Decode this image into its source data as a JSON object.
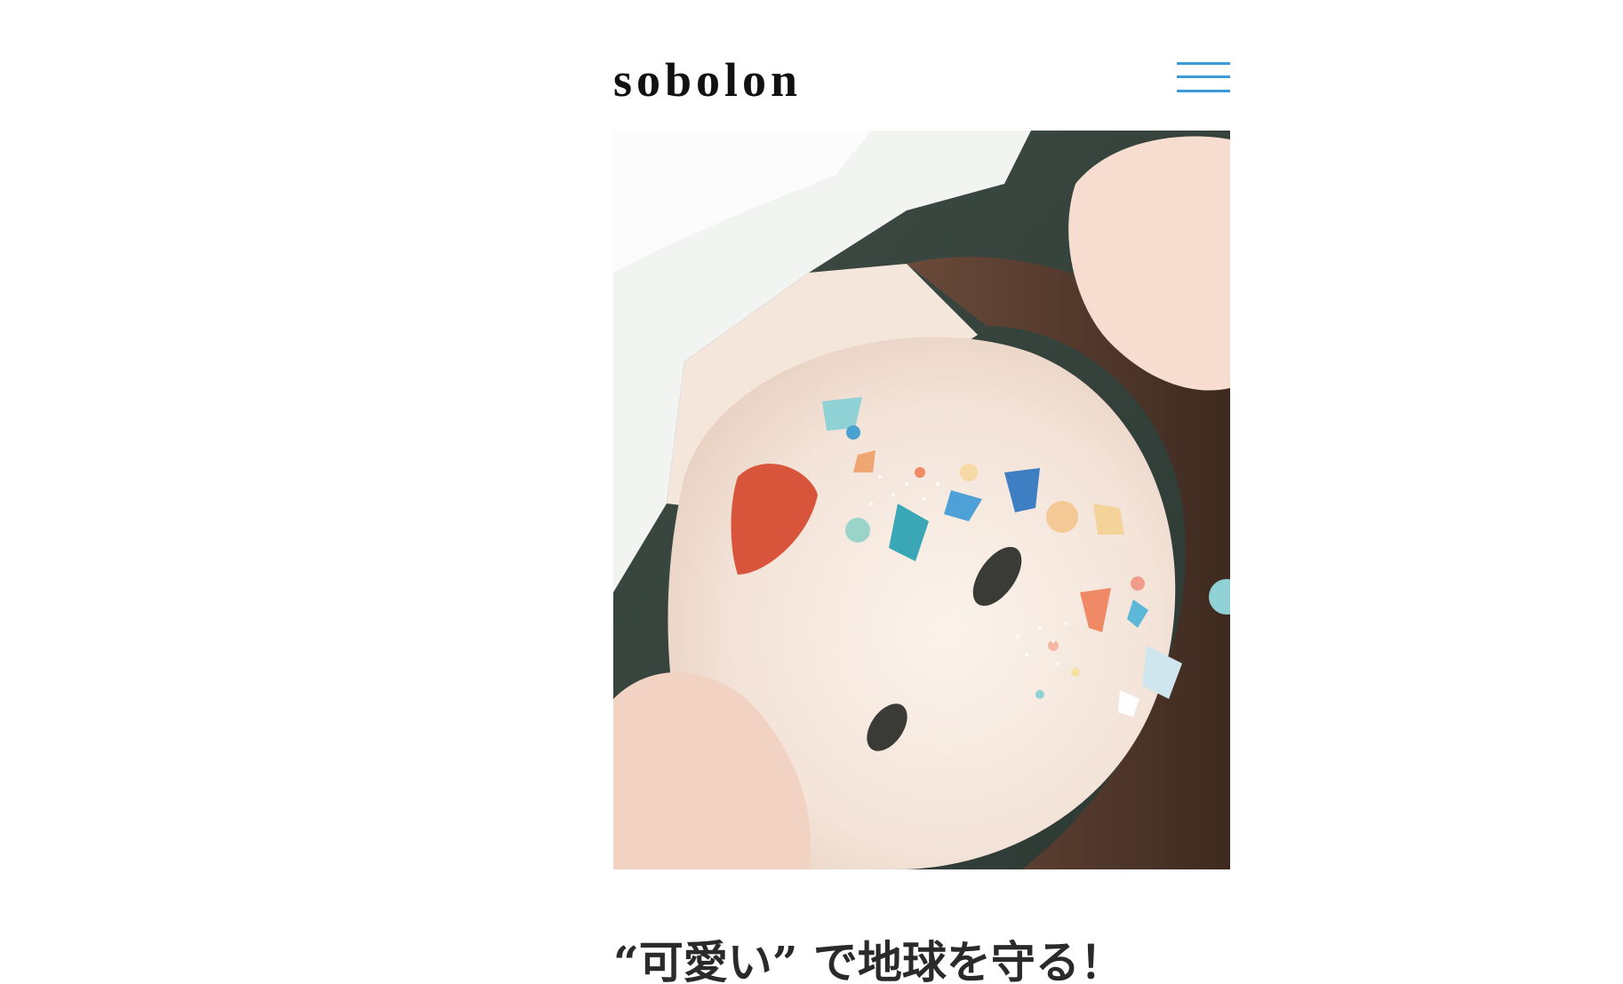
{
  "brand": {
    "logo_text": "sobolon"
  },
  "nav": {
    "menu_icon": "hamburger-menu-icon",
    "menu_color": "#3a9bd5"
  },
  "hero": {
    "image_subject": "woman lying on grass with colorful resin confetti accessories on face"
  },
  "headline": {
    "text": "“可愛い” で地球を守る！"
  },
  "colors": {
    "accent": "#3a9bd5",
    "text": "#2a2a2a",
    "background": "#ffffff"
  }
}
